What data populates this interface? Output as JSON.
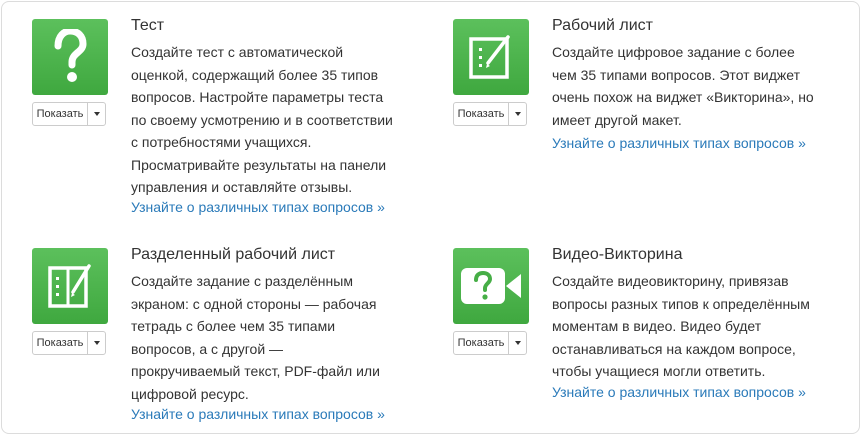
{
  "cards": [
    {
      "title": "Тест",
      "description_lines": [
        "Создайте тест с автоматической",
        "оценкой, содержащий более 35 типов",
        "вопросов. Настройте параметры теста",
        "по своему усмотрению и в соответствии",
        "с потребностями учащихся.",
        "Просматривайте результаты на панели",
        "управления и оставляйте отзывы."
      ],
      "link": "Узнайте о различных типах вопросов »",
      "button_label": "Показать",
      "icon": "question-mark-icon"
    },
    {
      "title": "Рабочий лист",
      "description_lines": [
        "Создайте цифровое задание с более",
        "чем 35 типами вопросов. Этот виджет",
        "очень похож на виджет «Викторина», но",
        "имеет другой макет."
      ],
      "link": "Узнайте о различных типах вопросов »",
      "button_label": "Показать",
      "icon": "worksheet-icon"
    },
    {
      "title": "Разделенный рабочий лист",
      "description_lines": [
        "Создайте задание с разделённым",
        "экраном: с одной стороны — рабочая",
        "тетрадь с более чем 35 типами",
        "вопросов, а с другой —",
        "прокручиваемый текст, PDF-файл или",
        "цифровой ресурс."
      ],
      "link": "Узнайте о различных типах вопросов »",
      "button_label": "Показать",
      "icon": "split-worksheet-icon"
    },
    {
      "title": "Видео-Викторина",
      "description_lines": [
        "Создайте видеовикторину, привязав",
        "вопросы разных типов к определённым",
        "моментам в видео. Видео будет",
        "останавливаться на каждом вопросе,",
        "чтобы учащиеся могли ответить."
      ],
      "link": "Узнайте о различных типах вопросов »",
      "button_label": "Показать",
      "icon": "video-quiz-icon"
    }
  ],
  "colors": {
    "icon_green": "#4cb84c",
    "link_blue": "#2a7ab9",
    "text": "#333333"
  }
}
